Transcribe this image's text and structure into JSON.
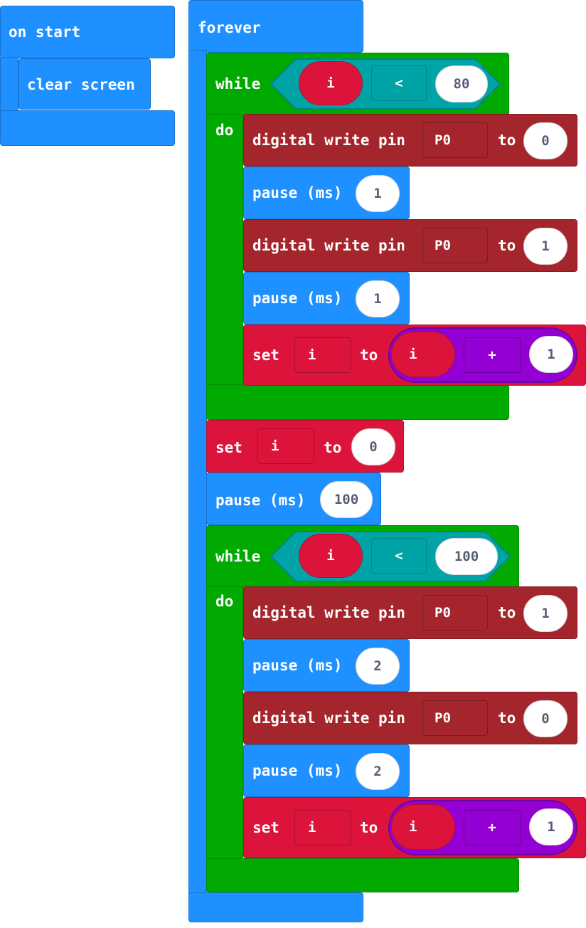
{
  "on_start": {
    "hat_label": "on start",
    "clear_label": "clear screen"
  },
  "forever": {
    "hat_label": "forever",
    "while1": {
      "keyword": "while",
      "do_label": "do",
      "var": "i",
      "op": "<",
      "limit": "80",
      "body": [
        {
          "type": "digital_write",
          "label": "digital write pin",
          "pin": "P0",
          "to": "to",
          "value": "0"
        },
        {
          "type": "pause",
          "label": "pause (ms)",
          "value": "1"
        },
        {
          "type": "digital_write",
          "label": "digital write pin",
          "pin": "P0",
          "to": "to",
          "value": "1"
        },
        {
          "type": "pause",
          "label": "pause (ms)",
          "value": "1"
        },
        {
          "type": "set",
          "label": "set",
          "var": "i",
          "to": "to",
          "expr_var": "i",
          "expr_op": "+",
          "expr_value": "1"
        }
      ]
    },
    "set_reset": {
      "label": "set",
      "var": "i",
      "to": "to",
      "value": "0"
    },
    "pause_mid": {
      "label": "pause (ms)",
      "value": "100"
    },
    "while2": {
      "keyword": "while",
      "do_label": "do",
      "var": "i",
      "op": "<",
      "limit": "100",
      "body": [
        {
          "type": "digital_write",
          "label": "digital write pin",
          "pin": "P0",
          "to": "to",
          "value": "1"
        },
        {
          "type": "pause",
          "label": "pause (ms)",
          "value": "2"
        },
        {
          "type": "digital_write",
          "label": "digital write pin",
          "pin": "P0",
          "to": "to",
          "value": "0"
        },
        {
          "type": "pause",
          "label": "pause (ms)",
          "value": "2"
        },
        {
          "type": "set",
          "label": "set",
          "var": "i",
          "to": "to",
          "expr_var": "i",
          "expr_op": "+",
          "expr_value": "1"
        }
      ]
    }
  },
  "colors": {
    "basic": "#1e90ff",
    "loops": "#00aa00",
    "pins": "#a4262c",
    "variables": "#dc143c",
    "logic": "#00a4a6",
    "math": "#9400d3"
  }
}
